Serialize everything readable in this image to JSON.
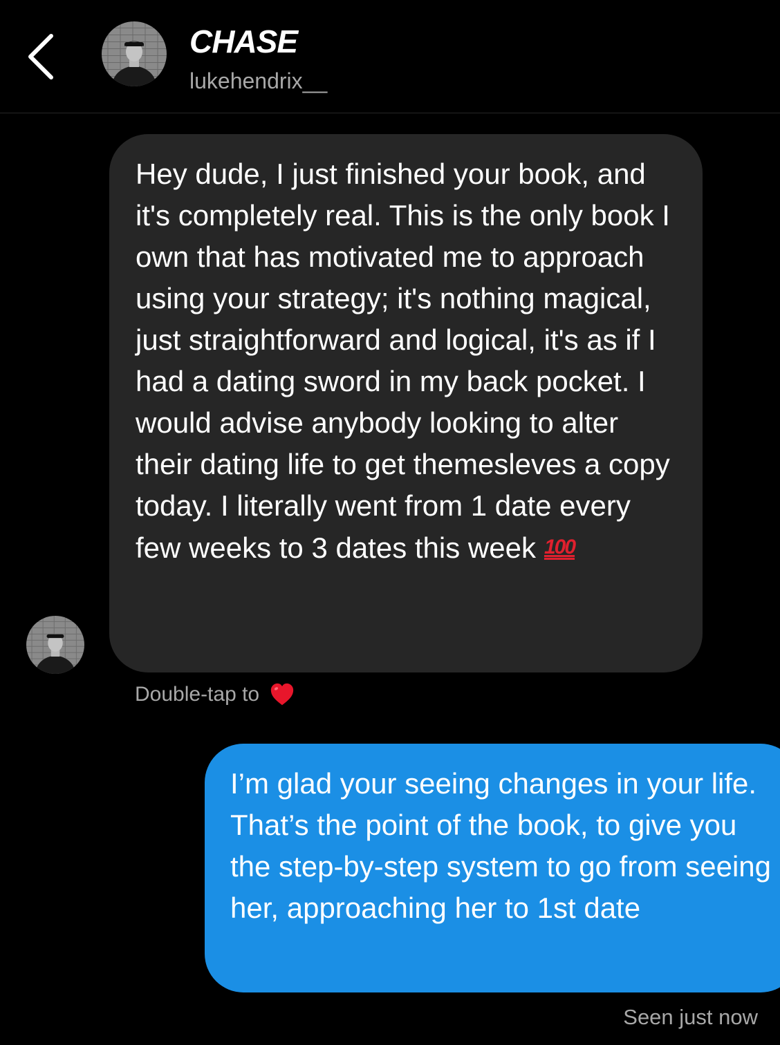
{
  "header": {
    "display_name": "CHASE",
    "username": "lukehendrix__",
    "back_icon": "chevron-left-icon"
  },
  "messages": {
    "incoming": {
      "text": "Hey dude, I just finished your book, and it's completely real. This is the only book I own that has motivated me to approach using your strategy; it's nothing magical, just straightforward and logical, it's as if I had a dating sword in my back pocket. I would advise anybody looking to alter their dating life to get themesleves a copy today. I literally went from 1 date every few weeks to 3 dates this week",
      "emoji": "100",
      "emoji_icon": "hundred-points-icon"
    },
    "hint": {
      "text": "Double-tap to",
      "icon": "heart-icon"
    },
    "outgoing": {
      "text": "I’m glad your seeing changes in your life. That’s the point of the book, to give you the step-by-step system to go from seeing her, approaching her to 1st date"
    },
    "seen": "Seen just now"
  },
  "colors": {
    "background": "#000000",
    "incoming_bubble": "#262626",
    "outgoing_bubble": "#1b8fe5",
    "secondary_text": "#a8a8a8",
    "heart": "#e8162b"
  }
}
